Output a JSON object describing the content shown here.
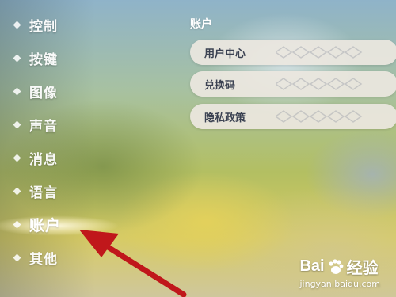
{
  "sidebar": {
    "items": [
      {
        "label": "控制",
        "active": false
      },
      {
        "label": "按键",
        "active": false
      },
      {
        "label": "图像",
        "active": false
      },
      {
        "label": "声音",
        "active": false
      },
      {
        "label": "消息",
        "active": false
      },
      {
        "label": "语言",
        "active": false
      },
      {
        "label": "账户",
        "active": true
      },
      {
        "label": "其他",
        "active": false
      }
    ]
  },
  "main": {
    "section_title": "账户",
    "buttons": [
      {
        "label": "用户中心"
      },
      {
        "label": "兑换码"
      },
      {
        "label": "隐私政策"
      }
    ]
  },
  "annotation": {
    "icon": "red-arrow-icon",
    "color": "#c0171b"
  },
  "watermark": {
    "logo_text_1": "Bai",
    "logo_text_2": "经验",
    "url": "jingyan.baidu.com"
  }
}
